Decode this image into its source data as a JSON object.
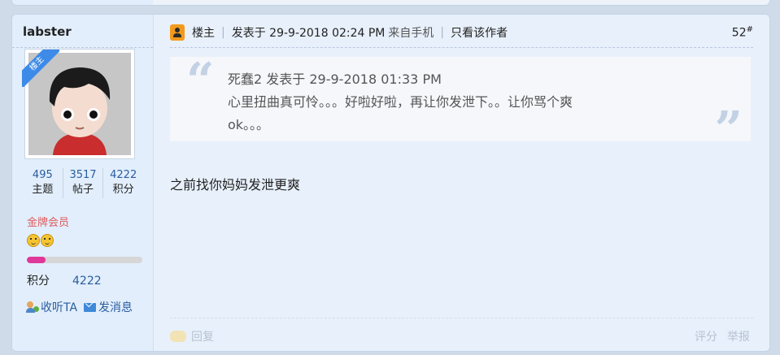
{
  "author": {
    "name": "labster",
    "ribbon": "楼主",
    "stats": [
      {
        "num": "495",
        "label": "主题"
      },
      {
        "num": "3517",
        "label": "帖子"
      },
      {
        "num": "4222",
        "label": "积分"
      }
    ],
    "rank": "金牌会员",
    "progress_percent": 16,
    "points_label": "积分",
    "points_value": "4222",
    "listen": "收听TA",
    "message": "发消息"
  },
  "post": {
    "owner_label": "楼主",
    "posted_at": "发表于 29-9-2018 02:24 PM",
    "device": "来自手机",
    "only_author": "只看该作者",
    "floor": "52",
    "floor_sup": "#",
    "quote": {
      "header": "死蠢2 发表于 29-9-2018 01:33 PM",
      "line1": "心里扭曲真可怜。。。好啦好啦，再让你发泄下。。让你骂个爽",
      "line2": "ok。。。"
    },
    "content": "之前找你妈妈发泄更爽",
    "reply": "回复",
    "rate": "评分",
    "report": "举报"
  }
}
